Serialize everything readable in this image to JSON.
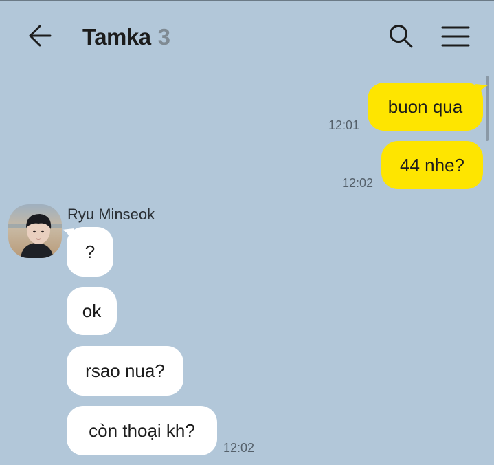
{
  "header": {
    "title": "Tamka",
    "member_count": "3",
    "back_icon": "arrow-left-icon",
    "search_icon": "search-icon",
    "menu_icon": "menu-icon"
  },
  "colors": {
    "background": "#b2c7d9",
    "outgoing_bubble": "#fee500",
    "incoming_bubble": "#ffffff"
  },
  "messages_out": [
    {
      "text": "buon qua",
      "time": "12:01"
    },
    {
      "text": "44 nhe?",
      "time": "12:02"
    }
  ],
  "sender": {
    "name": "Ryu Minseok"
  },
  "messages_in": [
    {
      "text": "?"
    },
    {
      "text": "ok"
    },
    {
      "text": "rsao nua?"
    },
    {
      "text": "còn thoại kh?",
      "time": "12:02"
    }
  ]
}
